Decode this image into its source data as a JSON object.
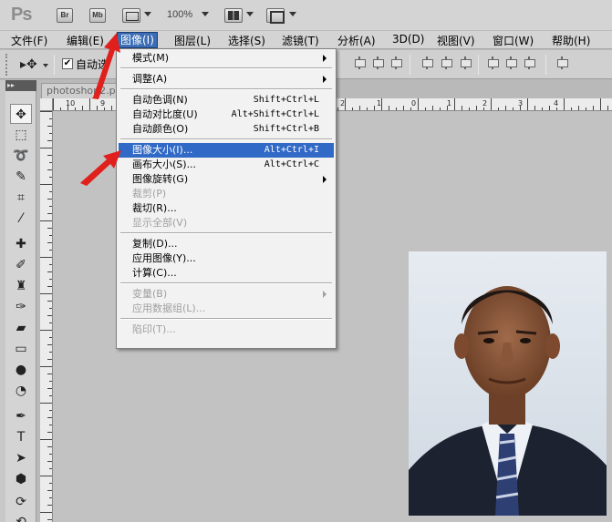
{
  "appbar": {
    "logo": "Ps",
    "bridge_label": "Br",
    "minibridge_label": "Mb",
    "zoom": "100%"
  },
  "menubar": {
    "items": [
      {
        "label": "文件(F)"
      },
      {
        "label": "编辑(E)"
      },
      {
        "label": "图像(I)"
      },
      {
        "label": "图层(L)"
      },
      {
        "label": "选择(S)"
      },
      {
        "label": "滤镜(T)"
      },
      {
        "label": "分析(A)"
      },
      {
        "label": "3D(D)"
      },
      {
        "label": "视图(V)"
      },
      {
        "label": "窗口(W)"
      },
      {
        "label": "帮助(H)"
      }
    ],
    "active": "图像(I)"
  },
  "options": {
    "auto_select_label": "自动选",
    "auto_select_checked": true
  },
  "document": {
    "tab_title": "photoshop2.p"
  },
  "ruler": {
    "top_numbers": [
      "10",
      "9",
      "2",
      "1",
      "0",
      "1",
      "2",
      "3",
      "4"
    ]
  },
  "image_menu": {
    "items": [
      {
        "label": "模式(M)",
        "shortcut": "",
        "submenu": true,
        "disabled": false,
        "highlighted": false
      },
      {
        "separator": true
      },
      {
        "label": "调整(A)",
        "shortcut": "",
        "submenu": true,
        "disabled": false,
        "highlighted": false
      },
      {
        "separator": true
      },
      {
        "label": "自动色调(N)",
        "shortcut": "Shift+Ctrl+L",
        "submenu": false,
        "disabled": false,
        "highlighted": false
      },
      {
        "label": "自动对比度(U)",
        "shortcut": "Alt+Shift+Ctrl+L",
        "submenu": false,
        "disabled": false,
        "highlighted": false
      },
      {
        "label": "自动颜色(O)",
        "shortcut": "Shift+Ctrl+B",
        "submenu": false,
        "disabled": false,
        "highlighted": false
      },
      {
        "separator": true
      },
      {
        "label": "图像大小(I)...",
        "shortcut": "Alt+Ctrl+I",
        "submenu": false,
        "disabled": false,
        "highlighted": true
      },
      {
        "label": "画布大小(S)...",
        "shortcut": "Alt+Ctrl+C",
        "submenu": false,
        "disabled": false,
        "highlighted": false
      },
      {
        "label": "图像旋转(G)",
        "shortcut": "",
        "submenu": true,
        "disabled": false,
        "highlighted": false
      },
      {
        "label": "裁剪(P)",
        "shortcut": "",
        "submenu": false,
        "disabled": true,
        "highlighted": false
      },
      {
        "label": "裁切(R)...",
        "shortcut": "",
        "submenu": false,
        "disabled": false,
        "highlighted": false
      },
      {
        "label": "显示全部(V)",
        "shortcut": "",
        "submenu": false,
        "disabled": true,
        "highlighted": false
      },
      {
        "separator": true
      },
      {
        "label": "复制(D)...",
        "shortcut": "",
        "submenu": false,
        "disabled": false,
        "highlighted": false
      },
      {
        "label": "应用图像(Y)...",
        "shortcut": "",
        "submenu": false,
        "disabled": false,
        "highlighted": false
      },
      {
        "label": "计算(C)...",
        "shortcut": "",
        "submenu": false,
        "disabled": false,
        "highlighted": false
      },
      {
        "separator": true
      },
      {
        "label": "变量(B)",
        "shortcut": "",
        "submenu": true,
        "disabled": true,
        "highlighted": false
      },
      {
        "label": "应用数据组(L)...",
        "shortcut": "",
        "submenu": false,
        "disabled": true,
        "highlighted": false
      },
      {
        "separator": true
      },
      {
        "label": "陷印(T)...",
        "shortcut": "",
        "submenu": false,
        "disabled": true,
        "highlighted": false
      }
    ]
  },
  "colors": {
    "highlight": "#3169c6",
    "menubar_active": "#3b6db6",
    "annotation_arrow": "#e0201c"
  },
  "tools": [
    "move-tool-icon",
    "marquee-tool-icon",
    "lasso-tool-icon",
    "quick-select-tool-icon",
    "crop-tool-icon",
    "eyedropper-tool-icon",
    "healing-brush-tool-icon",
    "brush-tool-icon",
    "clone-stamp-tool-icon",
    "history-brush-tool-icon",
    "eraser-tool-icon",
    "gradient-tool-icon",
    "blur-tool-icon",
    "dodge-tool-icon",
    "pen-tool-icon",
    "type-tool-icon",
    "path-select-tool-icon",
    "shape-tool-icon",
    "3d-rotate-tool-icon",
    "3d-orbit-tool-icon"
  ]
}
